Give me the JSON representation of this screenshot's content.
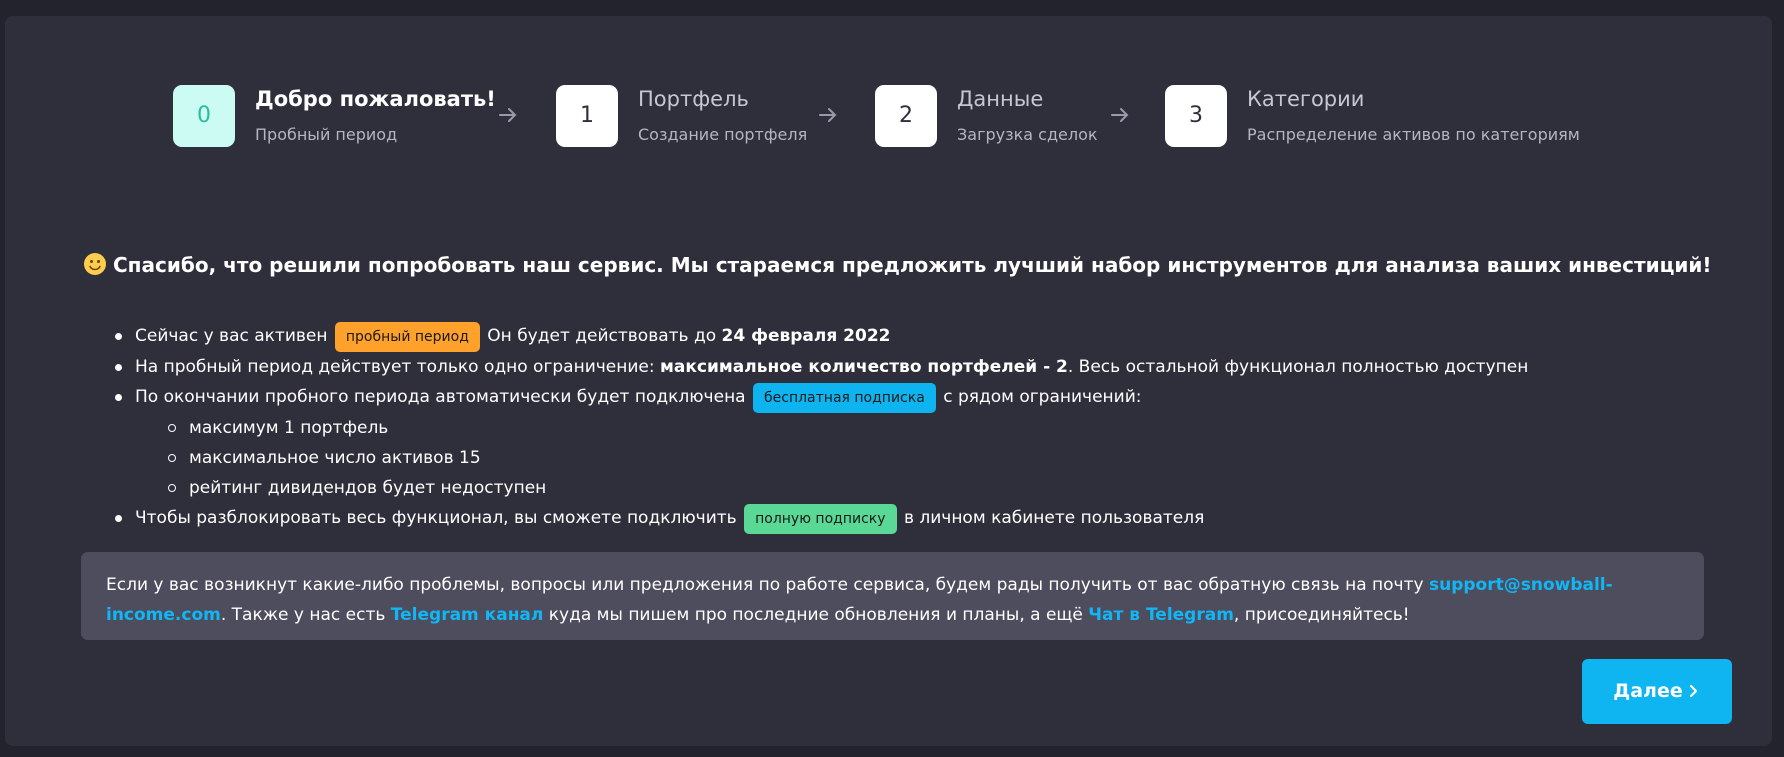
{
  "stepper": {
    "steps": [
      {
        "num": "0",
        "title": "Добро пожаловать!",
        "sub": "Пробный период",
        "active": true
      },
      {
        "num": "1",
        "title": "Портфель",
        "sub": "Создание портфеля",
        "active": false
      },
      {
        "num": "2",
        "title": "Данные",
        "sub": "Загрузка сделок",
        "active": false
      },
      {
        "num": "3",
        "title": "Категории",
        "sub": "Распределение активов по категориям",
        "active": false
      }
    ]
  },
  "heading": "Спасибо, что решили попробовать наш сервис. Мы стараемся предложить лучший набор инструментов для анализа ваших инвестиций!",
  "list": {
    "item1_pre": "Сейчас у вас активен",
    "item1_tag": "пробный период",
    "item1_post": "Он будет действовать до",
    "item1_date": "24 февраля 2022",
    "item2_pre": "На пробный период действует только одно ограничение:",
    "item2_bold": "максимальное количество портфелей - 2",
    "item2_post": ". Весь остальной функционал полностью доступен",
    "item3_pre": "По окончании пробного периода автоматически будет подключена",
    "item3_tag": "бесплатная подписка",
    "item3_post": "с рядом ограничений:",
    "sub_items": [
      "максимум 1 портфель",
      "максимальное число активов 15",
      "рейтинг дивидендов будет недоступен"
    ],
    "item4_pre": "Чтобы разблокировать весь функционал, вы сможете подключить",
    "item4_tag": "полную подписку",
    "item4_post": "в личном кабинете пользователя"
  },
  "info": {
    "text1": "Если у вас возникнут какие-либо проблемы, вопросы или предложения по работе сервиса, будем рады получить от вас обратную связь на почту",
    "email": "support@snowball-income.com",
    "text2": ". Также у нас есть",
    "telegram_channel": "Telegram канал",
    "text3": "куда мы пишем про последние обновления и планы, а ещё",
    "telegram_chat": "Чат в Telegram",
    "text4": ", присоединяйтесь!"
  },
  "next_button": "Далее",
  "colors": {
    "background": "#23232d",
    "panel": "#2f2f3c",
    "accent": "#0eb5f1",
    "trial_tag": "#ffa12b",
    "free_tag": "#0db4f0",
    "full_tag": "#5ad896",
    "info_box": "#4d4d5e",
    "active_step": "#cbfbf3"
  }
}
